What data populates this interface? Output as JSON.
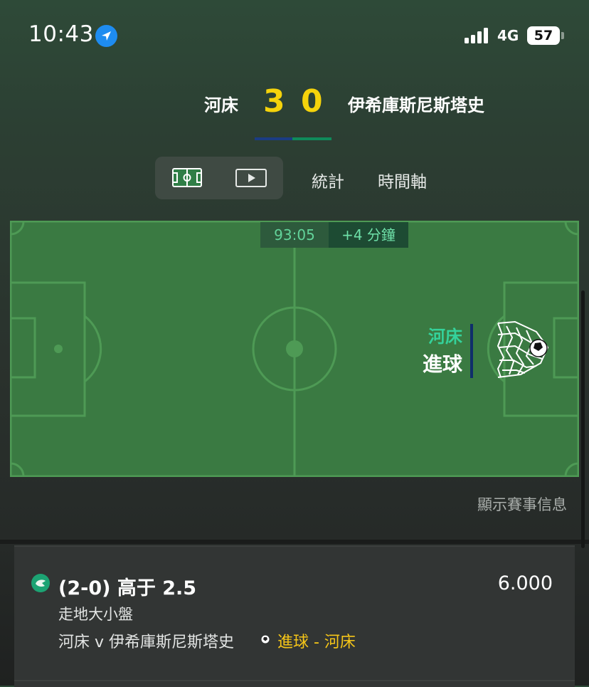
{
  "status": {
    "time": "10:43",
    "network": "4G",
    "battery": "57"
  },
  "match": {
    "home_team": "河床",
    "away_team": "伊希庫斯尼斯塔史",
    "home_score": "3",
    "away_score": "0"
  },
  "tabs": {
    "stats": "統計",
    "timeline": "時間軸"
  },
  "pitch": {
    "clock": "93:05",
    "added_time": "+4 分鐘",
    "event_team": "河床",
    "event_label": "進球"
  },
  "match_info_link": "顯示賽事信息",
  "bet": {
    "selection": "(2-0) 高于 2.5",
    "odds": "6.000",
    "market": "走地大小盤",
    "event": "河床 v 伊希庫斯尼斯塔史",
    "result": "進球 - 河床"
  },
  "colors": {
    "accent_score": "#f5d30b",
    "pitch_green": "#3a7a42",
    "home_bar": "#1b3c83",
    "away_bar": "#0f8a5a",
    "goal_team": "#34d29b",
    "result_yellow": "#f5c518"
  },
  "icons": [
    "location-arrow-icon",
    "signal-icon",
    "pitch-view-icon",
    "video-play-icon",
    "goal-net-icon",
    "bet-status-icon",
    "soccer-ball-icon"
  ]
}
